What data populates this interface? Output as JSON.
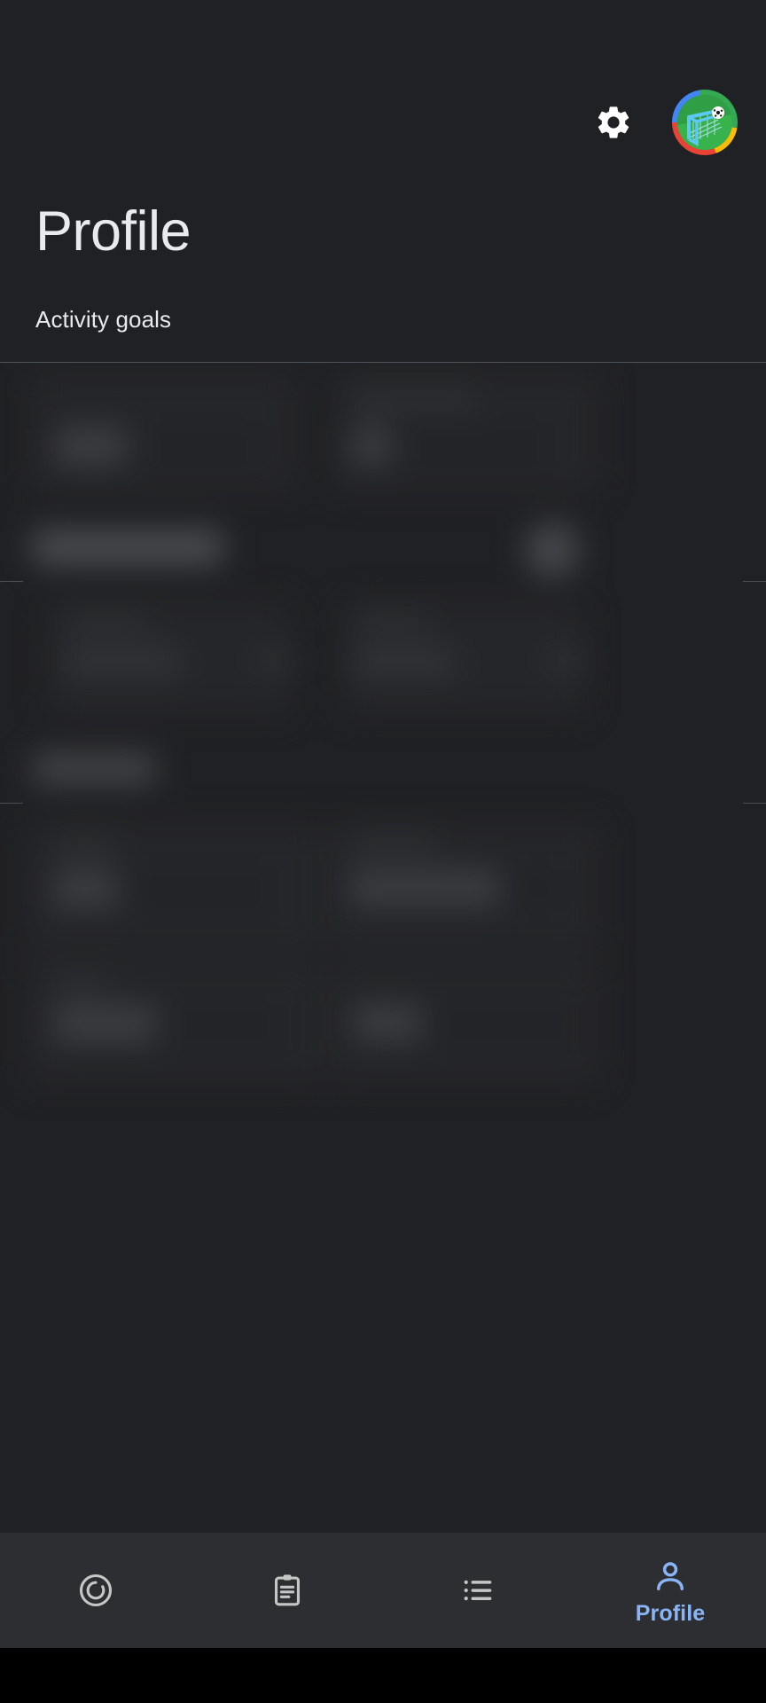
{
  "app": {
    "theme": "dark",
    "background_color": "#202124",
    "accent_color": "#8ab4f8",
    "surface_color": "#2d2e31"
  },
  "header": {
    "page_title": "Profile",
    "section_label": "Activity goals",
    "settings_icon": "gear-icon",
    "avatar_icon": "soccer-goal-avatar",
    "avatar_ring_colors": [
      "#ea4335",
      "#4285f4",
      "#34a853",
      "#fbbc05"
    ]
  },
  "content": {
    "state": "blurred",
    "note": "Main profile content is visually obscured/blurred in this screenshot"
  },
  "bottom_nav": {
    "active_index": 3,
    "items": [
      {
        "label": "",
        "icon": "activity-ring-icon",
        "active": false
      },
      {
        "label": "",
        "icon": "clipboard-icon",
        "active": false
      },
      {
        "label": "",
        "icon": "list-icon",
        "active": false
      },
      {
        "label": "Profile",
        "icon": "person-icon",
        "active": true
      }
    ]
  }
}
